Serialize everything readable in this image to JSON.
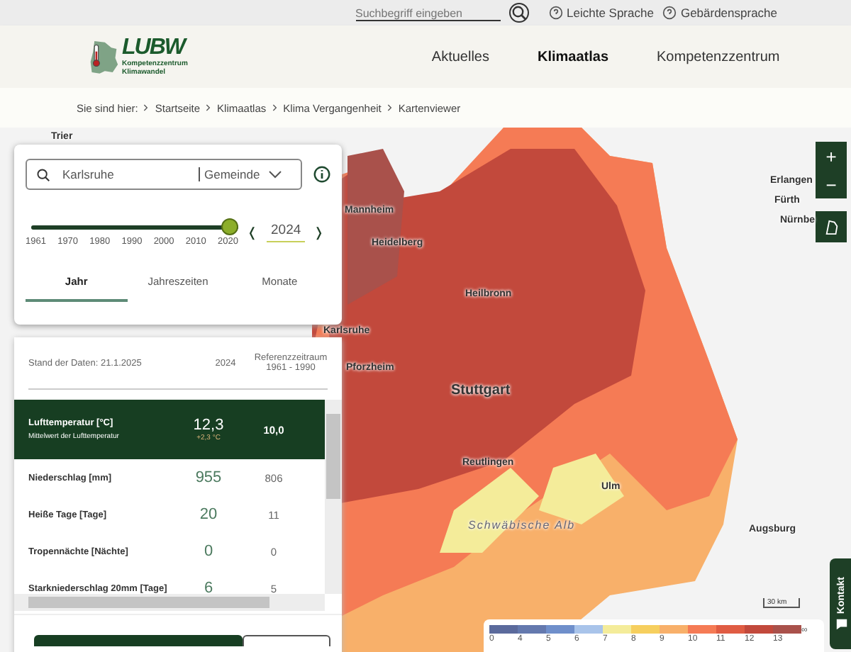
{
  "top_bar": {
    "search": {
      "placeholder": "Suchbegriff eingeben"
    },
    "links": [
      "Leichte Sprache",
      "Gebärdensprache"
    ]
  },
  "header": {
    "logo": {
      "wordmark": "LUBW",
      "line_1": "Kompetenzzentrum",
      "line_2": "Klimawandel"
    },
    "nav": [
      {
        "label": "Aktuelles",
        "selected": false
      },
      {
        "label": "Klimaatlas",
        "selected": true
      },
      {
        "label": "Kompetenzzentrum",
        "selected": false
      }
    ]
  },
  "breadcrumb": {
    "prefix": "Sie sind hier:",
    "items": [
      "Startseite",
      "Klimaatlas",
      "Klima Vergangenheit",
      "Kartenviewer"
    ]
  },
  "control_panel": {
    "search": {
      "value": "Karlsruhe",
      "scope": "Gemeinde"
    },
    "year_slider": {
      "level": 1.0,
      "ticks": [
        "1961",
        "1970",
        "1980",
        "1990",
        "2000",
        "2010",
        "2020"
      ],
      "year": "2024",
      "prev": "❬",
      "next": "❭"
    },
    "tabs": [
      {
        "label": "Jahr",
        "selected": true
      },
      {
        "label": "Jahreszeiten",
        "selected": false
      },
      {
        "label": "Monate",
        "selected": false
      }
    ]
  },
  "data_table": {
    "columns": [
      "Stand der Daten: 21.1.2025",
      "2024",
      "Referenzzeitraum 1961 - 1990"
    ],
    "rows": [
      {
        "name": "Lufttemperatur [°C]",
        "subtitle": "Mittelwert der Lufttemperatur",
        "value": "12,3",
        "delta": "+2,3 °C",
        "reference": "10,0",
        "selected": true
      },
      {
        "name": "Niederschlag [mm]",
        "value": "955",
        "reference": "806",
        "selected": false
      },
      {
        "name": "Heiße Tage [Tage]",
        "value": "20",
        "reference": "11",
        "selected": false
      },
      {
        "name": "Tropennächte [Nächte]",
        "value": "0",
        "reference": "0",
        "selected": false
      },
      {
        "name": "Starkniederschlag 20mm [Tage]",
        "value": "6",
        "reference": "5",
        "selected": false
      }
    ]
  },
  "map": {
    "labels": [
      {
        "text": "Trier",
        "kind": "city"
      },
      {
        "text": "Erlangen",
        "kind": "city"
      },
      {
        "text": "Fürth",
        "kind": "city"
      },
      {
        "text": "Mannheim",
        "kind": "city"
      },
      {
        "text": "Nürnbe",
        "kind": "city"
      },
      {
        "text": "Heidelberg",
        "kind": "city"
      },
      {
        "text": "Heilbronn",
        "kind": "city"
      },
      {
        "text": "Karlsruhe",
        "kind": "city"
      },
      {
        "text": "Pforzheim",
        "kind": "city"
      },
      {
        "text": "Stuttgart",
        "kind": "major"
      },
      {
        "text": "Reutlingen",
        "kind": "city"
      },
      {
        "text": "Ulm",
        "kind": "city"
      },
      {
        "text": "Schwäbische Alb",
        "kind": "region"
      },
      {
        "text": "Augsburg",
        "kind": "city"
      }
    ],
    "zoom_in": "+",
    "zoom_out": "−",
    "scale": "30 km",
    "legend": [
      {
        "label": "0",
        "color": "#5b6a9c"
      },
      {
        "label": "4",
        "color": "#6479ae"
      },
      {
        "label": "5",
        "color": "#6f8fcb"
      },
      {
        "label": "6",
        "color": "#a9c4ea"
      },
      {
        "label": "7",
        "color": "#f4ec9a"
      },
      {
        "label": "8",
        "color": "#f6cf5e"
      },
      {
        "label": "9",
        "color": "#f8b06a"
      },
      {
        "label": "10",
        "color": "#f57b55"
      },
      {
        "label": "11",
        "color": "#e05c43"
      },
      {
        "label": "12",
        "color": "#c2493c"
      },
      {
        "label": "13",
        "color": "#a9514b"
      },
      {
        "label": "∞"
      }
    ]
  },
  "contact_tab": "Kontakt"
}
